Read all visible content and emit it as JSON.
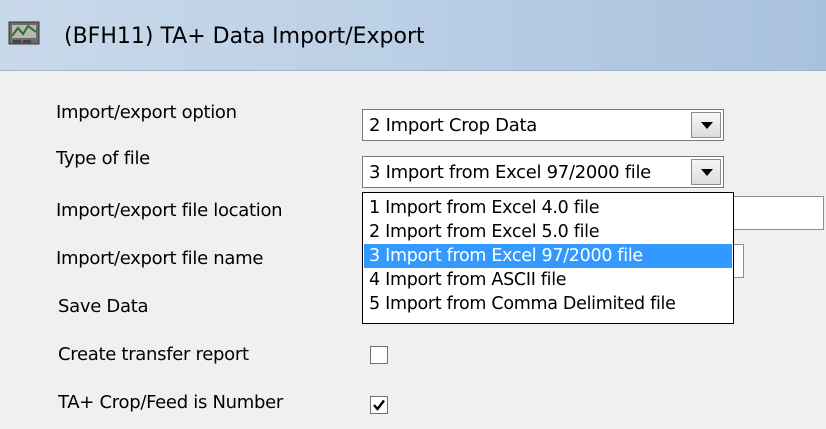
{
  "window": {
    "title": "(BFH11)  TA+ Data Import/Export",
    "icon": "application-icon"
  },
  "form": {
    "import_export_option": {
      "label": "Import/export option",
      "value": "2  Import Crop Data"
    },
    "type_of_file": {
      "label": "Type of file",
      "value": "3  Import from Excel 97/2000 file",
      "options": [
        "1  Import from Excel 4.0 file",
        "2  Import from Excel 5.0 file",
        "3  Import from Excel 97/2000 file",
        "4  Import from ASCII file",
        "5  Import from Comma Delimited file"
      ],
      "selected_index": 2
    },
    "file_location": {
      "label": "Import/export file location",
      "value": ""
    },
    "file_name": {
      "label": "Import/export file name",
      "value": ""
    },
    "save_data": {
      "label": "Save Data"
    },
    "create_transfer_report": {
      "label": "Create transfer report",
      "checked": false
    },
    "crop_feed_is_number": {
      "label": "TA+ Crop/Feed is Number",
      "checked": true
    }
  },
  "colors": {
    "selection": "#3399ff",
    "titlebar": "#bcd0e6"
  }
}
